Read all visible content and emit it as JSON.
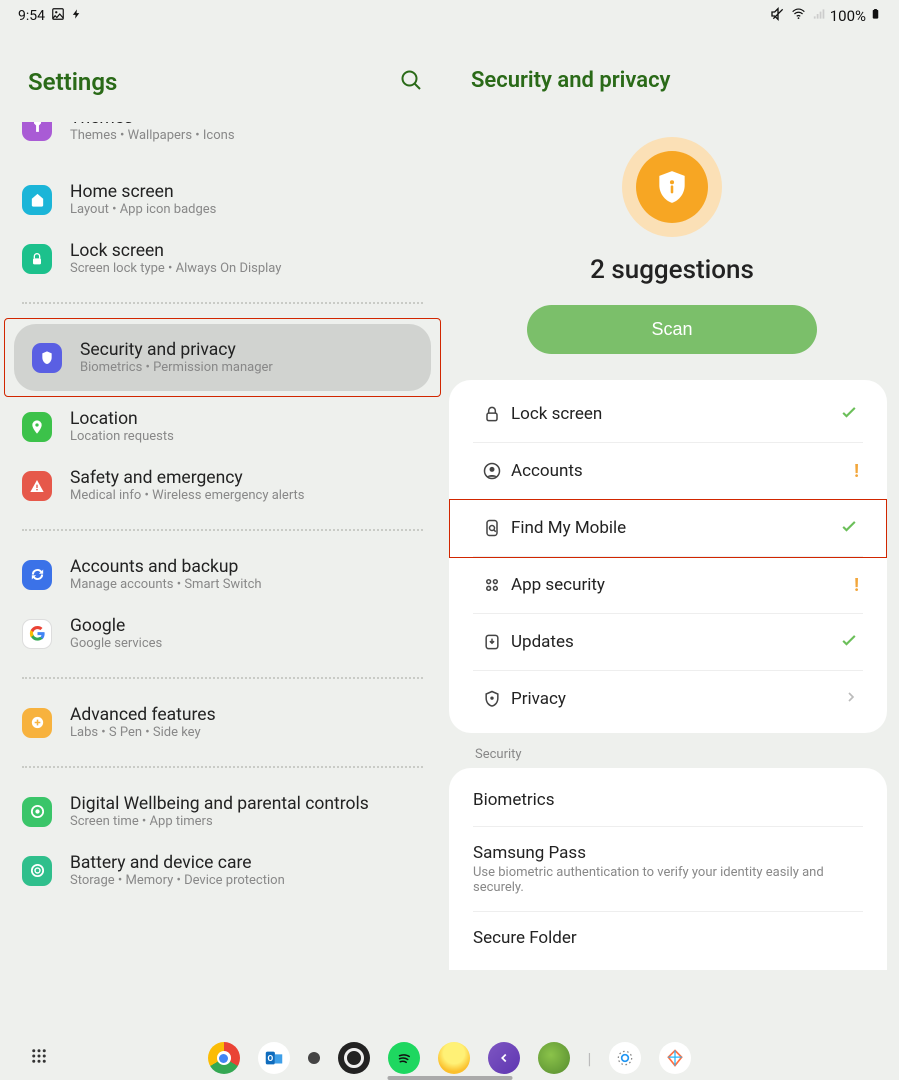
{
  "status": {
    "time": "9:54",
    "battery_text": "100%"
  },
  "left": {
    "title": "Settings",
    "items": [
      {
        "title": "Themes",
        "sub": "Themes  •  Wallpapers  •  Icons",
        "iconClass": "ic-purple",
        "iconName": "themes-icon"
      },
      {
        "title": "Home screen",
        "sub": "Layout  •  App icon badges",
        "iconClass": "ic-cyan",
        "iconName": "home-icon"
      },
      {
        "title": "Lock screen",
        "sub": "Screen lock type  •  Always On Display",
        "iconClass": "ic-teal",
        "iconName": "lock-icon"
      },
      {
        "title": "Security and privacy",
        "sub": "Biometrics  •  Permission manager",
        "iconClass": "ic-indigo",
        "iconName": "shield-icon",
        "selected": true,
        "highlight": true
      },
      {
        "title": "Location",
        "sub": "Location requests",
        "iconClass": "ic-green",
        "iconName": "pin-icon"
      },
      {
        "title": "Safety and emergency",
        "sub": "Medical info  •  Wireless emergency alerts",
        "iconClass": "ic-red",
        "iconName": "alert-icon"
      },
      {
        "title": "Accounts and backup",
        "sub": "Manage accounts  •  Smart Switch",
        "iconClass": "ic-blue",
        "iconName": "sync-icon"
      },
      {
        "title": "Google",
        "sub": "Google services",
        "iconClass": "ic-white",
        "iconName": "google-icon"
      },
      {
        "title": "Advanced features",
        "sub": "Labs  •  S Pen  •  Side key",
        "iconClass": "ic-orange",
        "iconName": "gear-plus-icon"
      },
      {
        "title": "Digital Wellbeing and parental controls",
        "sub": "Screen time  •  App timers",
        "iconClass": "ic-greeno",
        "iconName": "wellbeing-icon"
      },
      {
        "title": "Battery and device care",
        "sub": "Storage  •  Memory  •  Device protection",
        "iconClass": "ic-greenr",
        "iconName": "device-care-icon"
      }
    ],
    "dividers_after": [
      2,
      5,
      7,
      8
    ]
  },
  "right": {
    "title": "Security and privacy",
    "suggestions_label": "2 suggestions",
    "scan_label": "Scan",
    "status_items": [
      {
        "label": "Lock screen",
        "iconName": "lock-outline-icon",
        "status": "check"
      },
      {
        "label": "Accounts",
        "iconName": "account-circle-icon",
        "status": "warn"
      },
      {
        "label": "Find My Mobile",
        "iconName": "find-device-icon",
        "status": "check",
        "highlight": true
      },
      {
        "label": "App security",
        "iconName": "apps-icon",
        "status": "warn"
      },
      {
        "label": "Updates",
        "iconName": "update-shield-icon",
        "status": "check"
      },
      {
        "label": "Privacy",
        "iconName": "privacy-shield-icon",
        "status": "chev"
      }
    ],
    "section_label": "Security",
    "sec_items": [
      {
        "title": "Biometrics"
      },
      {
        "title": "Samsung Pass",
        "sub": "Use biometric authentication to verify your identity easily and securely."
      },
      {
        "title": "Secure Folder"
      }
    ]
  }
}
